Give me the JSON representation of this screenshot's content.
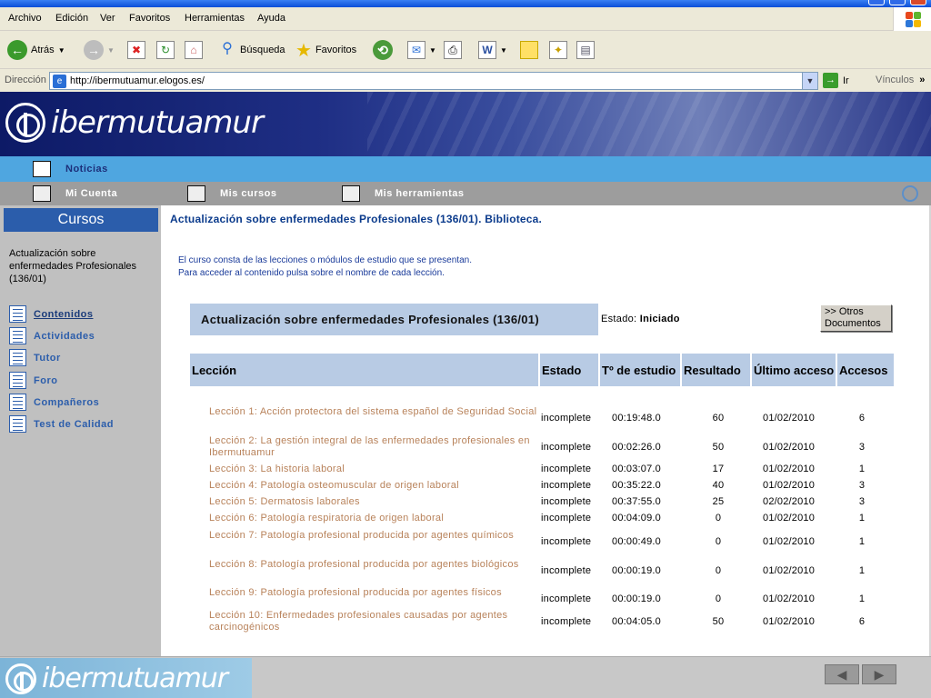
{
  "menubar": {
    "items": [
      "Archivo",
      "Edición",
      "Ver",
      "Favoritos",
      "Herramientas",
      "Ayuda"
    ]
  },
  "toolbar": {
    "back": "Atrás",
    "search": "Búsqueda",
    "favorites": "Favoritos"
  },
  "address": {
    "label": "Dirección",
    "url": "http://ibermutuamur.elogos.es/",
    "go": "Ir",
    "links": "Vínculos"
  },
  "brand": {
    "name": "ibermutuamur"
  },
  "nav": {
    "noticias": "Noticias",
    "cuenta": "Mi Cuenta",
    "cursos": "Mis cursos",
    "herramientas": "Mis herramientas"
  },
  "sidebar": {
    "header": "Cursos",
    "course": "Actualización sobre enfermedades Profesionales (136/01)",
    "items": [
      "Contenidos",
      "Actividades",
      "Tutor",
      "Foro",
      "Compañeros",
      "Test de Calidad"
    ]
  },
  "main": {
    "title": "Actualización sobre enfermedades Profesionales (136/01). Biblioteca.",
    "intro1": "El curso consta de las lecciones o módulos de estudio que se presentan.",
    "intro2": "Para acceder al contenido pulsa sobre el nombre de cada lección.",
    "course_header": "Actualización sobre enfermedades Profesionales (136/01)",
    "estado_label": "Estado:",
    "estado_value": "Iniciado",
    "otros_btn1": ">> Otros",
    "otros_btn2": "Documentos",
    "columns": [
      "Lección",
      "Estado",
      "Tº de estudio",
      "Resultado",
      "Último acceso",
      "Accesos"
    ],
    "rows": [
      {
        "lesson": "Lección 1: Acción protectora del sistema español de Seguridad Social",
        "estado": "incomplete",
        "tiempo": "00:19:48.0",
        "resultado": "60",
        "acceso": "01/02/2010",
        "accesos": "6"
      },
      {
        "lesson": "Lección 2: La gestión integral de las enfermedades profesionales en Ibermutuamur",
        "estado": "incomplete",
        "tiempo": "00:02:26.0",
        "resultado": "50",
        "acceso": "01/02/2010",
        "accesos": "3"
      },
      {
        "lesson": "Lección 3: La historia laboral",
        "estado": "incomplete",
        "tiempo": "00:03:07.0",
        "resultado": "17",
        "acceso": "01/02/2010",
        "accesos": "1"
      },
      {
        "lesson": "Lección 4: Patología osteomuscular de origen laboral",
        "estado": "incomplete",
        "tiempo": "00:35:22.0",
        "resultado": "40",
        "acceso": "01/02/2010",
        "accesos": "3"
      },
      {
        "lesson": "Lección 5: Dermatosis laborales",
        "estado": "incomplete",
        "tiempo": "00:37:55.0",
        "resultado": "25",
        "acceso": "02/02/2010",
        "accesos": "3"
      },
      {
        "lesson": "Lección 6: Patología respiratoria de origen laboral",
        "estado": "incomplete",
        "tiempo": "00:04:09.0",
        "resultado": "0",
        "acceso": "01/02/2010",
        "accesos": "1"
      },
      {
        "lesson": "Lección 7: Patología profesional producida por agentes químicos",
        "estado": "incomplete",
        "tiempo": "00:00:49.0",
        "resultado": "0",
        "acceso": "01/02/2010",
        "accesos": "1"
      },
      {
        "lesson": "Lección 8: Patología profesional producida por agentes biológicos",
        "estado": "incomplete",
        "tiempo": "00:00:19.0",
        "resultado": "0",
        "acceso": "01/02/2010",
        "accesos": "1"
      },
      {
        "lesson": "Lección 9: Patología profesional producida por agentes físicos",
        "estado": "incomplete",
        "tiempo": "00:00:19.0",
        "resultado": "0",
        "acceso": "01/02/2010",
        "accesos": "1"
      },
      {
        "lesson": "Lección 10: Enfermedades profesionales causadas por agentes carcinogénicos",
        "estado": "incomplete",
        "tiempo": "00:04:05.0",
        "resultado": "50",
        "acceso": "01/02/2010",
        "accesos": "6"
      }
    ]
  },
  "footer": {
    "prev_icon": "arrow-left-icon",
    "next_icon": "arrow-right-icon"
  }
}
